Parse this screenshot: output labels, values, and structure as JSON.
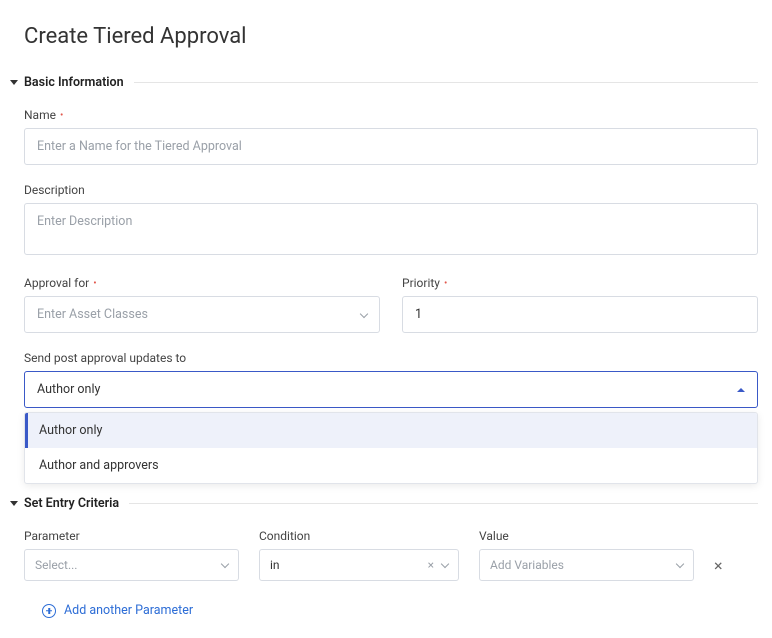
{
  "page": {
    "title": "Create Tiered Approval"
  },
  "sections": {
    "basic": {
      "title": "Basic Information",
      "fields": {
        "name": {
          "label": "Name",
          "required": true,
          "placeholder": "Enter a Name for the Tiered Approval",
          "value": ""
        },
        "description": {
          "label": "Description",
          "required": false,
          "placeholder": "Enter Description",
          "value": ""
        },
        "approval_for": {
          "label": "Approval for",
          "required": true,
          "placeholder": "Enter Asset Classes",
          "value": ""
        },
        "priority": {
          "label": "Priority",
          "required": true,
          "value": "1"
        },
        "send_updates": {
          "label": "Send post approval updates to",
          "value": "Author only",
          "options": [
            "Author only",
            "Author and approvers"
          ],
          "expanded": true
        }
      }
    },
    "criteria": {
      "title": "Set Entry Criteria",
      "columns": {
        "parameter": "Parameter",
        "condition": "Condition",
        "value": "Value"
      },
      "rows": [
        {
          "parameter_placeholder": "Select...",
          "parameter": "",
          "condition": "in",
          "value_placeholder": "Add Variables",
          "value": ""
        }
      ],
      "add_label": "Add another Parameter"
    }
  }
}
